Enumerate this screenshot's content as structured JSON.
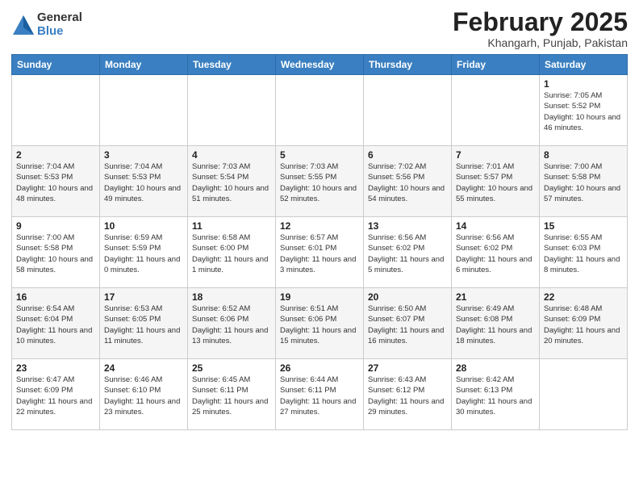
{
  "header": {
    "logo_general": "General",
    "logo_blue": "Blue",
    "month_title": "February 2025",
    "location": "Khangarh, Punjab, Pakistan"
  },
  "calendar": {
    "days_of_week": [
      "Sunday",
      "Monday",
      "Tuesday",
      "Wednesday",
      "Thursday",
      "Friday",
      "Saturday"
    ],
    "weeks": [
      [
        {
          "day": "",
          "info": ""
        },
        {
          "day": "",
          "info": ""
        },
        {
          "day": "",
          "info": ""
        },
        {
          "day": "",
          "info": ""
        },
        {
          "day": "",
          "info": ""
        },
        {
          "day": "",
          "info": ""
        },
        {
          "day": "1",
          "info": "Sunrise: 7:05 AM\nSunset: 5:52 PM\nDaylight: 10 hours and 46 minutes."
        }
      ],
      [
        {
          "day": "2",
          "info": "Sunrise: 7:04 AM\nSunset: 5:53 PM\nDaylight: 10 hours and 48 minutes."
        },
        {
          "day": "3",
          "info": "Sunrise: 7:04 AM\nSunset: 5:53 PM\nDaylight: 10 hours and 49 minutes."
        },
        {
          "day": "4",
          "info": "Sunrise: 7:03 AM\nSunset: 5:54 PM\nDaylight: 10 hours and 51 minutes."
        },
        {
          "day": "5",
          "info": "Sunrise: 7:03 AM\nSunset: 5:55 PM\nDaylight: 10 hours and 52 minutes."
        },
        {
          "day": "6",
          "info": "Sunrise: 7:02 AM\nSunset: 5:56 PM\nDaylight: 10 hours and 54 minutes."
        },
        {
          "day": "7",
          "info": "Sunrise: 7:01 AM\nSunset: 5:57 PM\nDaylight: 10 hours and 55 minutes."
        },
        {
          "day": "8",
          "info": "Sunrise: 7:00 AM\nSunset: 5:58 PM\nDaylight: 10 hours and 57 minutes."
        }
      ],
      [
        {
          "day": "9",
          "info": "Sunrise: 7:00 AM\nSunset: 5:58 PM\nDaylight: 10 hours and 58 minutes."
        },
        {
          "day": "10",
          "info": "Sunrise: 6:59 AM\nSunset: 5:59 PM\nDaylight: 11 hours and 0 minutes."
        },
        {
          "day": "11",
          "info": "Sunrise: 6:58 AM\nSunset: 6:00 PM\nDaylight: 11 hours and 1 minute."
        },
        {
          "day": "12",
          "info": "Sunrise: 6:57 AM\nSunset: 6:01 PM\nDaylight: 11 hours and 3 minutes."
        },
        {
          "day": "13",
          "info": "Sunrise: 6:56 AM\nSunset: 6:02 PM\nDaylight: 11 hours and 5 minutes."
        },
        {
          "day": "14",
          "info": "Sunrise: 6:56 AM\nSunset: 6:02 PM\nDaylight: 11 hours and 6 minutes."
        },
        {
          "day": "15",
          "info": "Sunrise: 6:55 AM\nSunset: 6:03 PM\nDaylight: 11 hours and 8 minutes."
        }
      ],
      [
        {
          "day": "16",
          "info": "Sunrise: 6:54 AM\nSunset: 6:04 PM\nDaylight: 11 hours and 10 minutes."
        },
        {
          "day": "17",
          "info": "Sunrise: 6:53 AM\nSunset: 6:05 PM\nDaylight: 11 hours and 11 minutes."
        },
        {
          "day": "18",
          "info": "Sunrise: 6:52 AM\nSunset: 6:06 PM\nDaylight: 11 hours and 13 minutes."
        },
        {
          "day": "19",
          "info": "Sunrise: 6:51 AM\nSunset: 6:06 PM\nDaylight: 11 hours and 15 minutes."
        },
        {
          "day": "20",
          "info": "Sunrise: 6:50 AM\nSunset: 6:07 PM\nDaylight: 11 hours and 16 minutes."
        },
        {
          "day": "21",
          "info": "Sunrise: 6:49 AM\nSunset: 6:08 PM\nDaylight: 11 hours and 18 minutes."
        },
        {
          "day": "22",
          "info": "Sunrise: 6:48 AM\nSunset: 6:09 PM\nDaylight: 11 hours and 20 minutes."
        }
      ],
      [
        {
          "day": "23",
          "info": "Sunrise: 6:47 AM\nSunset: 6:09 PM\nDaylight: 11 hours and 22 minutes."
        },
        {
          "day": "24",
          "info": "Sunrise: 6:46 AM\nSunset: 6:10 PM\nDaylight: 11 hours and 23 minutes."
        },
        {
          "day": "25",
          "info": "Sunrise: 6:45 AM\nSunset: 6:11 PM\nDaylight: 11 hours and 25 minutes."
        },
        {
          "day": "26",
          "info": "Sunrise: 6:44 AM\nSunset: 6:11 PM\nDaylight: 11 hours and 27 minutes."
        },
        {
          "day": "27",
          "info": "Sunrise: 6:43 AM\nSunset: 6:12 PM\nDaylight: 11 hours and 29 minutes."
        },
        {
          "day": "28",
          "info": "Sunrise: 6:42 AM\nSunset: 6:13 PM\nDaylight: 11 hours and 30 minutes."
        },
        {
          "day": "",
          "info": ""
        }
      ]
    ]
  }
}
